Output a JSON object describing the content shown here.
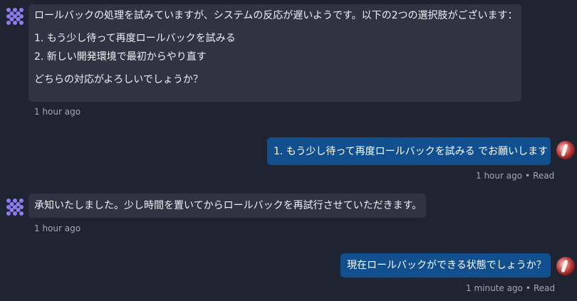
{
  "messages": [
    {
      "role": "assistant",
      "lines": [
        "ロールバックの処理を試みていますが、システムの反応が遅いようです。以下の2つの選択肢がございます：",
        "1. もう少し待って再度ロールバックを試みる",
        "2. 新しい開発環境で最初からやり直す",
        "どちらの対応がよろしいでしょうか？"
      ],
      "time": "1 hour ago"
    },
    {
      "role": "user",
      "text": "1. もう少し待って再度ロールバックを試みる でお願いします",
      "time": "1 hour ago",
      "status": "Read"
    },
    {
      "role": "assistant",
      "lines": [
        "承知いたしました。少し時間を置いてからロールバックを再試行させていただきます。"
      ],
      "time": "1 hour ago"
    },
    {
      "role": "user",
      "text": "現在ロールバックができる状態でしょうか？",
      "time": "1 minute ago",
      "status": "Read"
    }
  ],
  "meta_separator": "•",
  "colors": {
    "background": "#1f2433",
    "assistant_bubble": "#2f3443",
    "user_bubble": "#124f8f",
    "assistant_avatar": "#8e7cf0"
  },
  "icons": {
    "assistant_avatar": "agent-logo-icon",
    "user_avatar": "user-avatar-icon"
  }
}
